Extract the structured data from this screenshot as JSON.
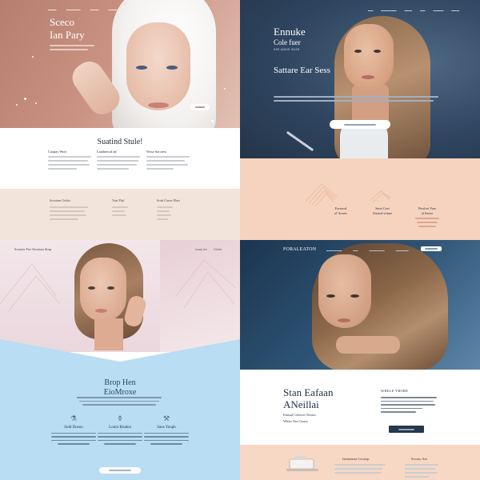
{
  "q1": {
    "brand_line1": "Sceco",
    "brand_line2": "Ian Pary",
    "hero_button": "",
    "section_title": "Suatind Stule!",
    "columns": [
      {
        "heading": "Caopay Wort"
      },
      {
        "heading": "Laathercsd ad"
      },
      {
        "heading": "Wose Sorctest"
      }
    ],
    "band_columns": [
      {
        "heading": "Scosiom Oxlict"
      },
      {
        "heading": "Yeat Fluf"
      },
      {
        "heading": "Scait Cueas Flurt"
      }
    ]
  },
  "q2": {
    "title_line1": "Ennuke",
    "title_line2": "Cole fuer",
    "tagline": "SSE ANDIE SOAR",
    "subtitle": "Sattare Ear Sess",
    "features": [
      {
        "line1": "Foraswd",
        "line2": "ol' Scoeis"
      },
      {
        "line1": "Seret Cext",
        "line2": "Aiztrod wiiure"
      },
      {
        "line1": "Pewlcet Yare",
        "line2": "al Sonve"
      }
    ]
  },
  "q3": {
    "brand": "Soorete Foe Secrtom Stop",
    "nav": [
      "Comp lex",
      "Clnitte"
    ],
    "title_line1": "Brop Hen",
    "title_line2": "EioMroxe",
    "features": [
      {
        "icon": "bottles-icon",
        "glyph": "⚗",
        "heading": "Sold Dosoo"
      },
      {
        "icon": "cosmetics-icon",
        "glyph": "⚱",
        "heading": "Lonin Brudea"
      },
      {
        "icon": "tools-icon",
        "glyph": "⚒",
        "heading": "Saos Yonph"
      }
    ]
  },
  "q4": {
    "brand": "FORALEATON",
    "title_line1": "Stan Eafaan",
    "title_line2": "ANeillai",
    "line3": "Etinsal Celetcet Nesses",
    "line4": "Whiet Noe Gaase",
    "side_heading": "WRELE YBORE",
    "band_col1": "Iantrnauae Ceooop",
    "band_col2": "Svossy Ase"
  }
}
